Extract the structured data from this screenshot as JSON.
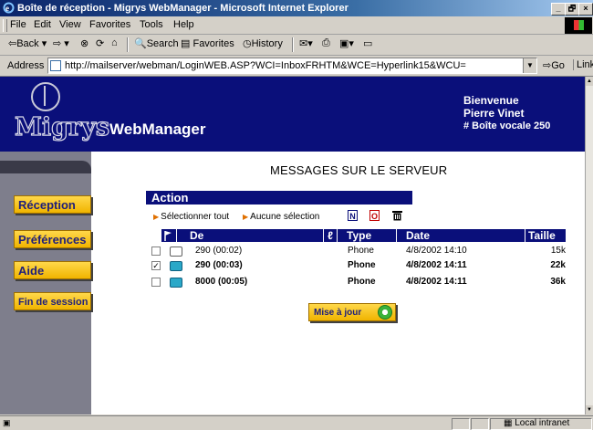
{
  "window": {
    "title": "Boîte de réception - Migrys WebManager - Microsoft Internet Explorer",
    "controls": [
      "_",
      "🗗",
      "×"
    ]
  },
  "menu": [
    "File",
    "Edit",
    "View",
    "Favorites",
    "Tools",
    "Help"
  ],
  "toolbar": {
    "back": "Back",
    "search": "Search",
    "favorites": "Favorites",
    "history": "History"
  },
  "address": {
    "label": "Address",
    "url": "http://mailserver/webman/LoginWEB.ASP?WCI=InboxFRHTM&WCE=Hyperlink15&WCU=",
    "go": "Go",
    "links": "Links"
  },
  "header": {
    "logo_text": "Migrys",
    "product": "WebManager",
    "welcome": "Bienvenue",
    "user": "Pierre Vinet",
    "mailbox": "# Boîte vocale 250"
  },
  "nav": {
    "items": [
      {
        "label": "Réception"
      },
      {
        "label": "Préférences"
      },
      {
        "label": "Aide"
      },
      {
        "label": "Fin de session"
      }
    ]
  },
  "main": {
    "heading": "MESSAGES SUR LE SERVEUR",
    "action_title": "Action",
    "select_all": "Sélectionner tout",
    "select_none": "Aucune sélection",
    "columns": {
      "from": "De",
      "type": "Type",
      "date": "Date",
      "size": "Taille"
    },
    "messages": [
      {
        "checked": false,
        "from": "290 (00:02)",
        "type": "Phone",
        "date": "4/8/2002 14:10",
        "size": "15k",
        "unread": false
      },
      {
        "checked": true,
        "from": "290 (00:03)",
        "type": "Phone",
        "date": "4/8/2002 14:11",
        "size": "22k",
        "unread": true
      },
      {
        "checked": false,
        "from": "8000 (00:05)",
        "type": "Phone",
        "date": "4/8/2002 14:11",
        "size": "36k",
        "unread": true
      }
    ],
    "update_button": "Mise à jour"
  },
  "status": {
    "zone": "Local intranet"
  },
  "colors": {
    "header_bg": "#0a0f7a",
    "nav_button": "#f0b400",
    "nav_panel": "#7e7e8c"
  }
}
